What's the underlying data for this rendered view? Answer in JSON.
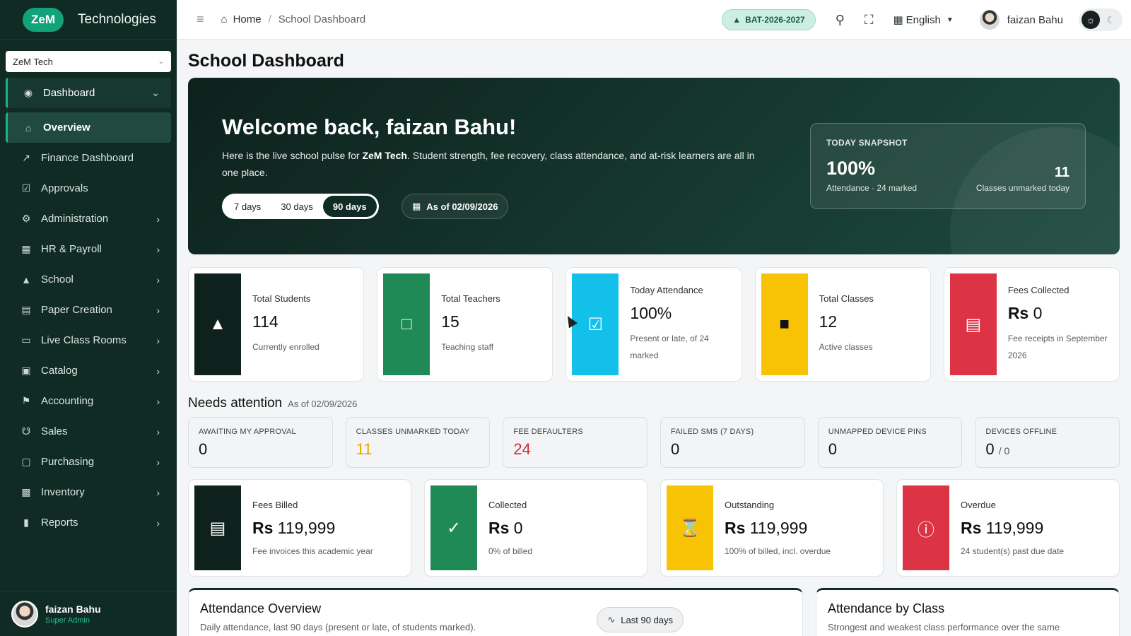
{
  "sidebar": {
    "brand_logo": "ZeM",
    "brand_name": "Technologies",
    "org": "ZeM Tech",
    "items": [
      {
        "label": "Dashboard",
        "icon": "palette-icon"
      },
      {
        "label": "Overview",
        "icon": "home-icon"
      },
      {
        "label": "Finance Dashboard",
        "icon": "chart-line-icon"
      },
      {
        "label": "Approvals",
        "icon": "check-square-icon"
      },
      {
        "label": "Administration",
        "icon": "gear-icon"
      },
      {
        "label": "HR & Payroll",
        "icon": "badge-icon"
      },
      {
        "label": "School",
        "icon": "graduation-cap-icon"
      },
      {
        "label": "Paper Creation",
        "icon": "document-icon"
      },
      {
        "label": "Live Class Rooms",
        "icon": "video-icon"
      },
      {
        "label": "Catalog",
        "icon": "box-icon"
      },
      {
        "label": "Accounting",
        "icon": "bank-icon"
      },
      {
        "label": "Sales",
        "icon": "cart-icon"
      },
      {
        "label": "Purchasing",
        "icon": "bag-icon"
      },
      {
        "label": "Inventory",
        "icon": "boxes-icon"
      },
      {
        "label": "Reports",
        "icon": "bar-chart-icon"
      }
    ],
    "user": {
      "name": "faizan Bahu",
      "role": "Super Admin"
    }
  },
  "topbar": {
    "breadcrumb_home": "Home",
    "breadcrumb_separator": "/",
    "breadcrumb_current": "School Dashboard",
    "batch": "BAT-2026-2027",
    "language": "English",
    "user_name": "faizan Bahu"
  },
  "page": {
    "title": "School Dashboard"
  },
  "hero": {
    "title": "Welcome back, faizan Bahu!",
    "subtitle_pre": "Here is the live school pulse for ",
    "subtitle_org": "ZeM Tech",
    "subtitle_post": ". Student strength, fee recovery, class attendance, and at-risk learners are all in one place.",
    "ranges": [
      "7 days",
      "30 days",
      "90 days"
    ],
    "selected_range": "90 days",
    "as_of": "As of 02/09/2026",
    "snapshot": {
      "label": "TODAY SNAPSHOT",
      "attendance": "100%",
      "attendance_sub": "Attendance · 24 marked",
      "unmarked": "11",
      "unmarked_label": "Classes unmarked today"
    }
  },
  "stats": [
    {
      "label": "Total Students",
      "currency": "",
      "value": "114",
      "desc": "Currently enrolled",
      "color": "#0e211c",
      "icon": "graduation-cap-icon"
    },
    {
      "label": "Total Teachers",
      "currency": "",
      "value": "15",
      "desc": "Teaching staff",
      "color": "#1f8a55",
      "icon": "teacher-icon"
    },
    {
      "label": "Today Attendance",
      "currency": "",
      "value": "100%",
      "desc": "Present or late, of 24 marked",
      "color": "#13c0ea",
      "icon": "calendar-check-icon"
    },
    {
      "label": "Total Classes",
      "currency": "",
      "value": "12",
      "desc": "Active classes",
      "color": "#f7c304",
      "icon": "easel-icon"
    },
    {
      "label": "Fees Collected",
      "currency": "Rs",
      "value": "0",
      "desc": "Fee receipts in September 2026",
      "color": "#dc3444",
      "icon": "cash-icon"
    }
  ],
  "attention": {
    "title": "Needs attention",
    "date": "As of 02/09/2026",
    "cards": [
      {
        "label": "AWAITING MY APPROVAL",
        "value": "0",
        "suffix": "",
        "color": "#111111"
      },
      {
        "label": "CLASSES UNMARKED TODAY",
        "value": "11",
        "suffix": "",
        "color": "#e8a400"
      },
      {
        "label": "FEE DEFAULTERS",
        "value": "24",
        "suffix": "",
        "color": "#d12a3a"
      },
      {
        "label": "FAILED SMS (7 DAYS)",
        "value": "0",
        "suffix": "",
        "color": "#111111"
      },
      {
        "label": "UNMAPPED DEVICE PINS",
        "value": "0",
        "suffix": "",
        "color": "#111111"
      },
      {
        "label": "DEVICES OFFLINE",
        "value": "0",
        "suffix": "/ 0",
        "color": "#111111"
      }
    ]
  },
  "finance": [
    {
      "label": "Fees Billed",
      "currency": "Rs",
      "value": "119,999",
      "desc": "Fee invoices this academic year",
      "color": "#0e211c",
      "icon": "invoice-icon"
    },
    {
      "label": "Collected",
      "currency": "Rs",
      "value": "0",
      "desc": "0% of billed",
      "color": "#1f8a55",
      "icon": "check-circle-icon"
    },
    {
      "label": "Outstanding",
      "currency": "Rs",
      "value": "119,999",
      "desc": "100% of billed, incl. overdue",
      "color": "#f7c304",
      "icon": "hourglass-icon"
    },
    {
      "label": "Overdue",
      "currency": "Rs",
      "value": "119,999",
      "desc": "24 student(s) past due date",
      "color": "#dc3444",
      "icon": "alert-circle-icon"
    }
  ],
  "panels": {
    "attendance_overview": {
      "title": "Attendance Overview",
      "subtitle": "Daily attendance, last 90 days (present or late, of students marked).",
      "pill": "Last 90 days"
    },
    "attendance_by_class": {
      "title": "Attendance by Class",
      "subtitle": "Strongest and weakest class performance over the same"
    }
  }
}
